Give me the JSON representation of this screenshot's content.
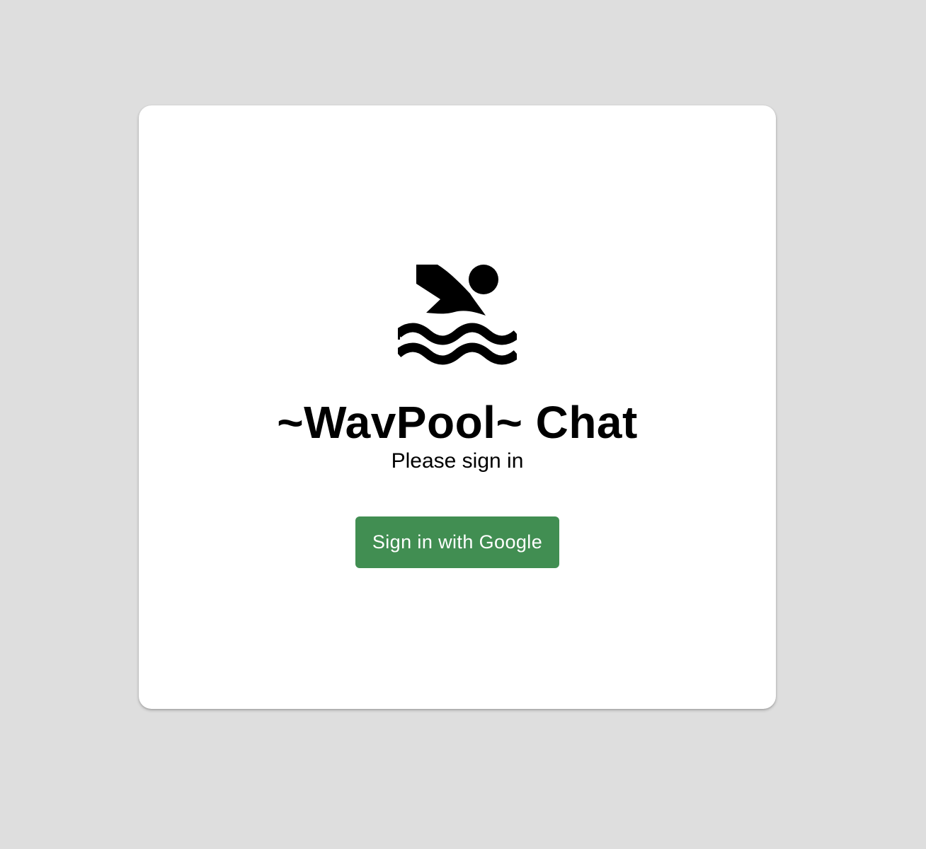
{
  "app": {
    "icon": "swimmer-icon",
    "title": "~WavPool~ Chat",
    "subtitle": "Please sign in"
  },
  "auth": {
    "google_button_label": "Sign in with Google",
    "button_color": "#418e52"
  },
  "theme": {
    "page_background": "#dedede",
    "card_background": "#ffffff"
  }
}
